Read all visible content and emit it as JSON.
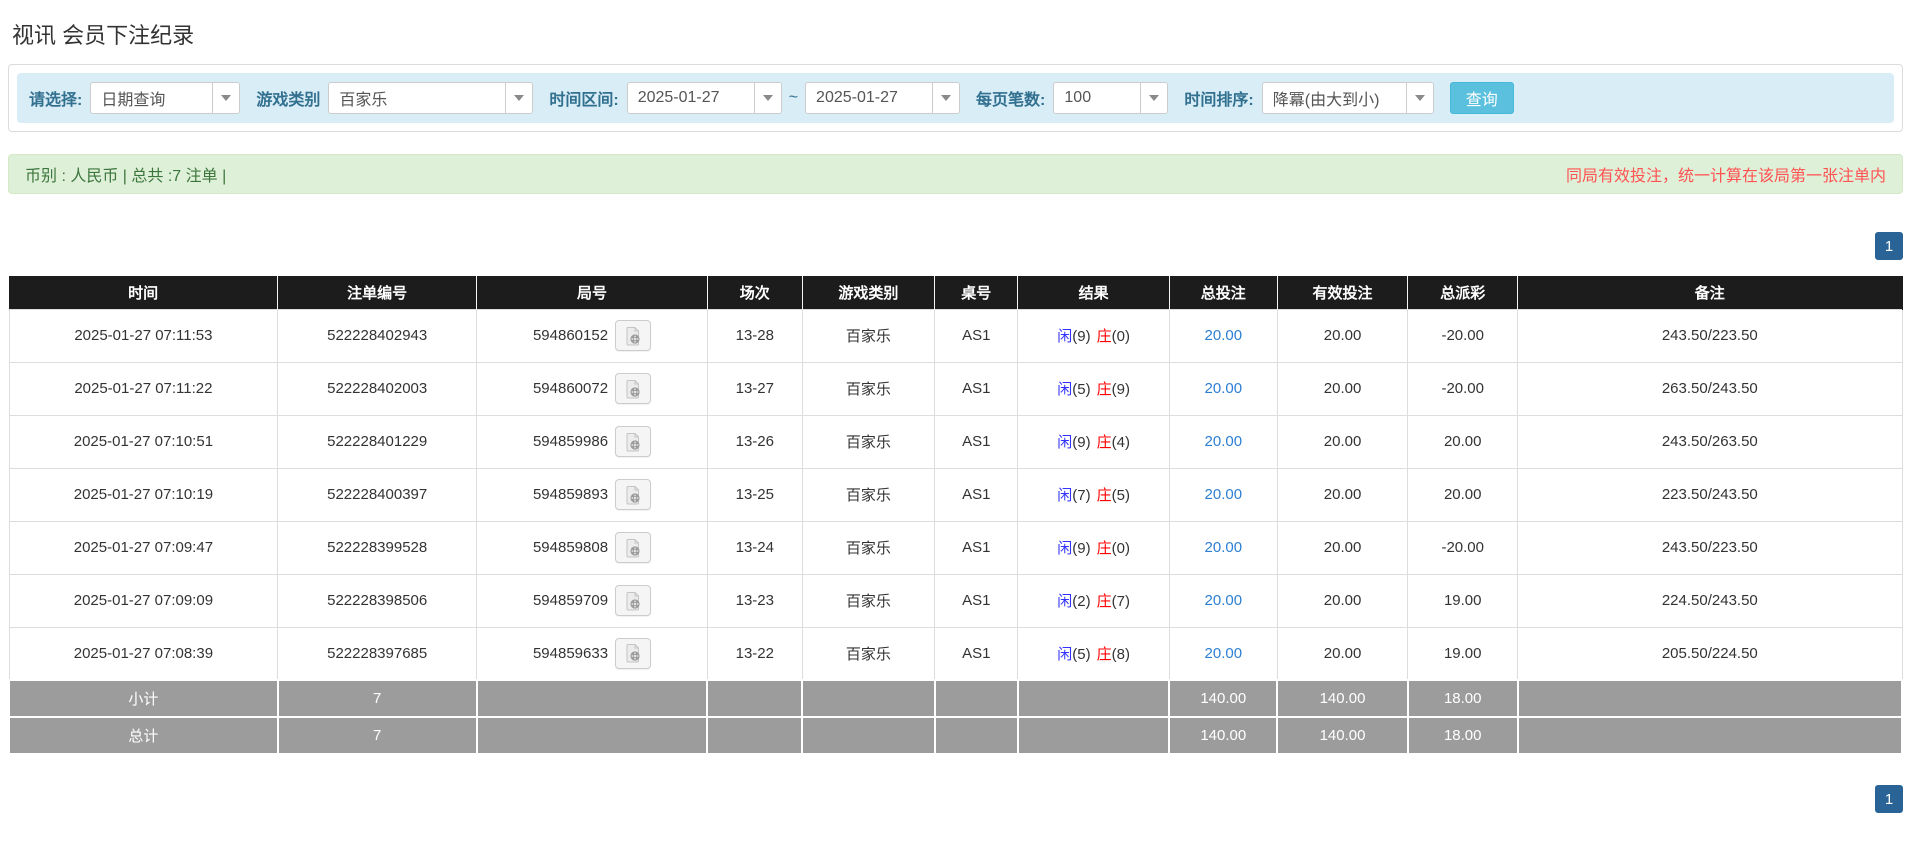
{
  "page": {
    "title": "视讯 会员下注纪录"
  },
  "filters": {
    "select_label": "请选择:",
    "select_value": "日期查询",
    "game_label": "游戏类别",
    "game_value": "百家乐",
    "range_label": "时间区间:",
    "date_from": "2025-01-27",
    "tilde": "~",
    "date_to": "2025-01-27",
    "per_page_label": "每页笔数:",
    "per_page_value": "100",
    "sort_label": "时间排序:",
    "sort_value": "降冪(由大到小)",
    "search_button": "查询"
  },
  "summary": {
    "left": "币别 : 人民币 | 总共 :7 注单 |",
    "right_note": "同局有效投注，统一计算在该局第一张注单内"
  },
  "pagination": {
    "page": "1"
  },
  "table": {
    "headers": [
      "时间",
      "注单编号",
      "局号",
      "场次",
      "游戏类别",
      "桌号",
      "结果",
      "总投注",
      "有效投注",
      "总派彩",
      "备注"
    ],
    "rows": [
      {
        "time": "2025-01-27 07:11:53",
        "bet_id": "522228402943",
        "round_id": "594860152",
        "session": "13-28",
        "game": "百家乐",
        "table_no": "AS1",
        "result_player_label": "闲",
        "result_player_value": "(9)",
        "result_banker_label": "庄",
        "result_banker_value": "(0)",
        "total_bet": "20.00",
        "valid_bet": "20.00",
        "payout": "-20.00",
        "remark": "243.50/223.50"
      },
      {
        "time": "2025-01-27 07:11:22",
        "bet_id": "522228402003",
        "round_id": "594860072",
        "session": "13-27",
        "game": "百家乐",
        "table_no": "AS1",
        "result_player_label": "闲",
        "result_player_value": "(5)",
        "result_banker_label": "庄",
        "result_banker_value": "(9)",
        "total_bet": "20.00",
        "valid_bet": "20.00",
        "payout": "-20.00",
        "remark": "263.50/243.50"
      },
      {
        "time": "2025-01-27 07:10:51",
        "bet_id": "522228401229",
        "round_id": "594859986",
        "session": "13-26",
        "game": "百家乐",
        "table_no": "AS1",
        "result_player_label": "闲",
        "result_player_value": "(9)",
        "result_banker_label": "庄",
        "result_banker_value": "(4)",
        "total_bet": "20.00",
        "valid_bet": "20.00",
        "payout": "20.00",
        "remark": "243.50/263.50"
      },
      {
        "time": "2025-01-27 07:10:19",
        "bet_id": "522228400397",
        "round_id": "594859893",
        "session": "13-25",
        "game": "百家乐",
        "table_no": "AS1",
        "result_player_label": "闲",
        "result_player_value": "(7)",
        "result_banker_label": "庄",
        "result_banker_value": "(5)",
        "total_bet": "20.00",
        "valid_bet": "20.00",
        "payout": "20.00",
        "remark": "223.50/243.50"
      },
      {
        "time": "2025-01-27 07:09:47",
        "bet_id": "522228399528",
        "round_id": "594859808",
        "session": "13-24",
        "game": "百家乐",
        "table_no": "AS1",
        "result_player_label": "闲",
        "result_player_value": "(9)",
        "result_banker_label": "庄",
        "result_banker_value": "(0)",
        "total_bet": "20.00",
        "valid_bet": "20.00",
        "payout": "-20.00",
        "remark": "243.50/223.50"
      },
      {
        "time": "2025-01-27 07:09:09",
        "bet_id": "522228398506",
        "round_id": "594859709",
        "session": "13-23",
        "game": "百家乐",
        "table_no": "AS1",
        "result_player_label": "闲",
        "result_player_value": "(2)",
        "result_banker_label": "庄",
        "result_banker_value": "(7)",
        "total_bet": "20.00",
        "valid_bet": "20.00",
        "payout": "19.00",
        "remark": "224.50/243.50"
      },
      {
        "time": "2025-01-27 07:08:39",
        "bet_id": "522228397685",
        "round_id": "594859633",
        "session": "13-22",
        "game": "百家乐",
        "table_no": "AS1",
        "result_player_label": "闲",
        "result_player_value": "(5)",
        "result_banker_label": "庄",
        "result_banker_value": "(8)",
        "total_bet": "20.00",
        "valid_bet": "20.00",
        "payout": "19.00",
        "remark": "205.50/224.50"
      }
    ],
    "subtotal": {
      "label": "小计",
      "count": "7",
      "total_bet": "140.00",
      "valid_bet": "140.00",
      "payout": "18.00"
    },
    "total": {
      "label": "总计",
      "count": "7",
      "total_bet": "140.00",
      "valid_bet": "140.00",
      "payout": "18.00"
    }
  },
  "colors": {
    "filter_bar_bg": "#d9edf7",
    "filter_label": "#31708f",
    "search_button_bg": "#5bc0de",
    "summary_bg": "#dff0d8",
    "summary_text": "#3c763d",
    "warning_text": "#ff5252",
    "pagination_bg": "#2a6496",
    "header_bg": "#1c1c1c",
    "link_blue": "#2d7fd3",
    "player_blue": "#3333ff",
    "banker_red": "#ff0000",
    "negative_red": "#ff0000",
    "subtotal_bg": "#9c9c9c"
  },
  "icons": {
    "video_replay": "video-record-icon",
    "dropdown": "chevron-down-icon"
  }
}
